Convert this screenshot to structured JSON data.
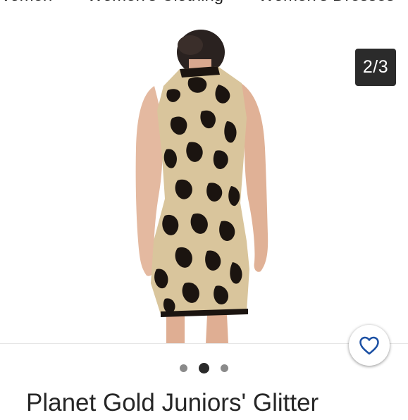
{
  "breadcrumb": {
    "items": [
      {
        "label": "Women"
      },
      {
        "label": "Women's Clothing"
      },
      {
        "label": "Women's Dresses"
      }
    ],
    "separator": "›"
  },
  "gallery": {
    "counter": "2/3",
    "current_index": 2,
    "total": 3,
    "product_image_alt": "Leopard print sleeveless mock-neck dress, back view",
    "favorite_icon": "heart-outline-icon",
    "colors": {
      "counter_bg": "#2b2b2b",
      "favorite_icon": "#1a4fa3",
      "dress_base": "#d9c59c",
      "dress_spots": "#1b1410"
    }
  },
  "pagination": {
    "dots": [
      "1",
      "2",
      "3"
    ],
    "active": 2
  },
  "product": {
    "title": "Planet Gold Juniors' Glitter"
  }
}
